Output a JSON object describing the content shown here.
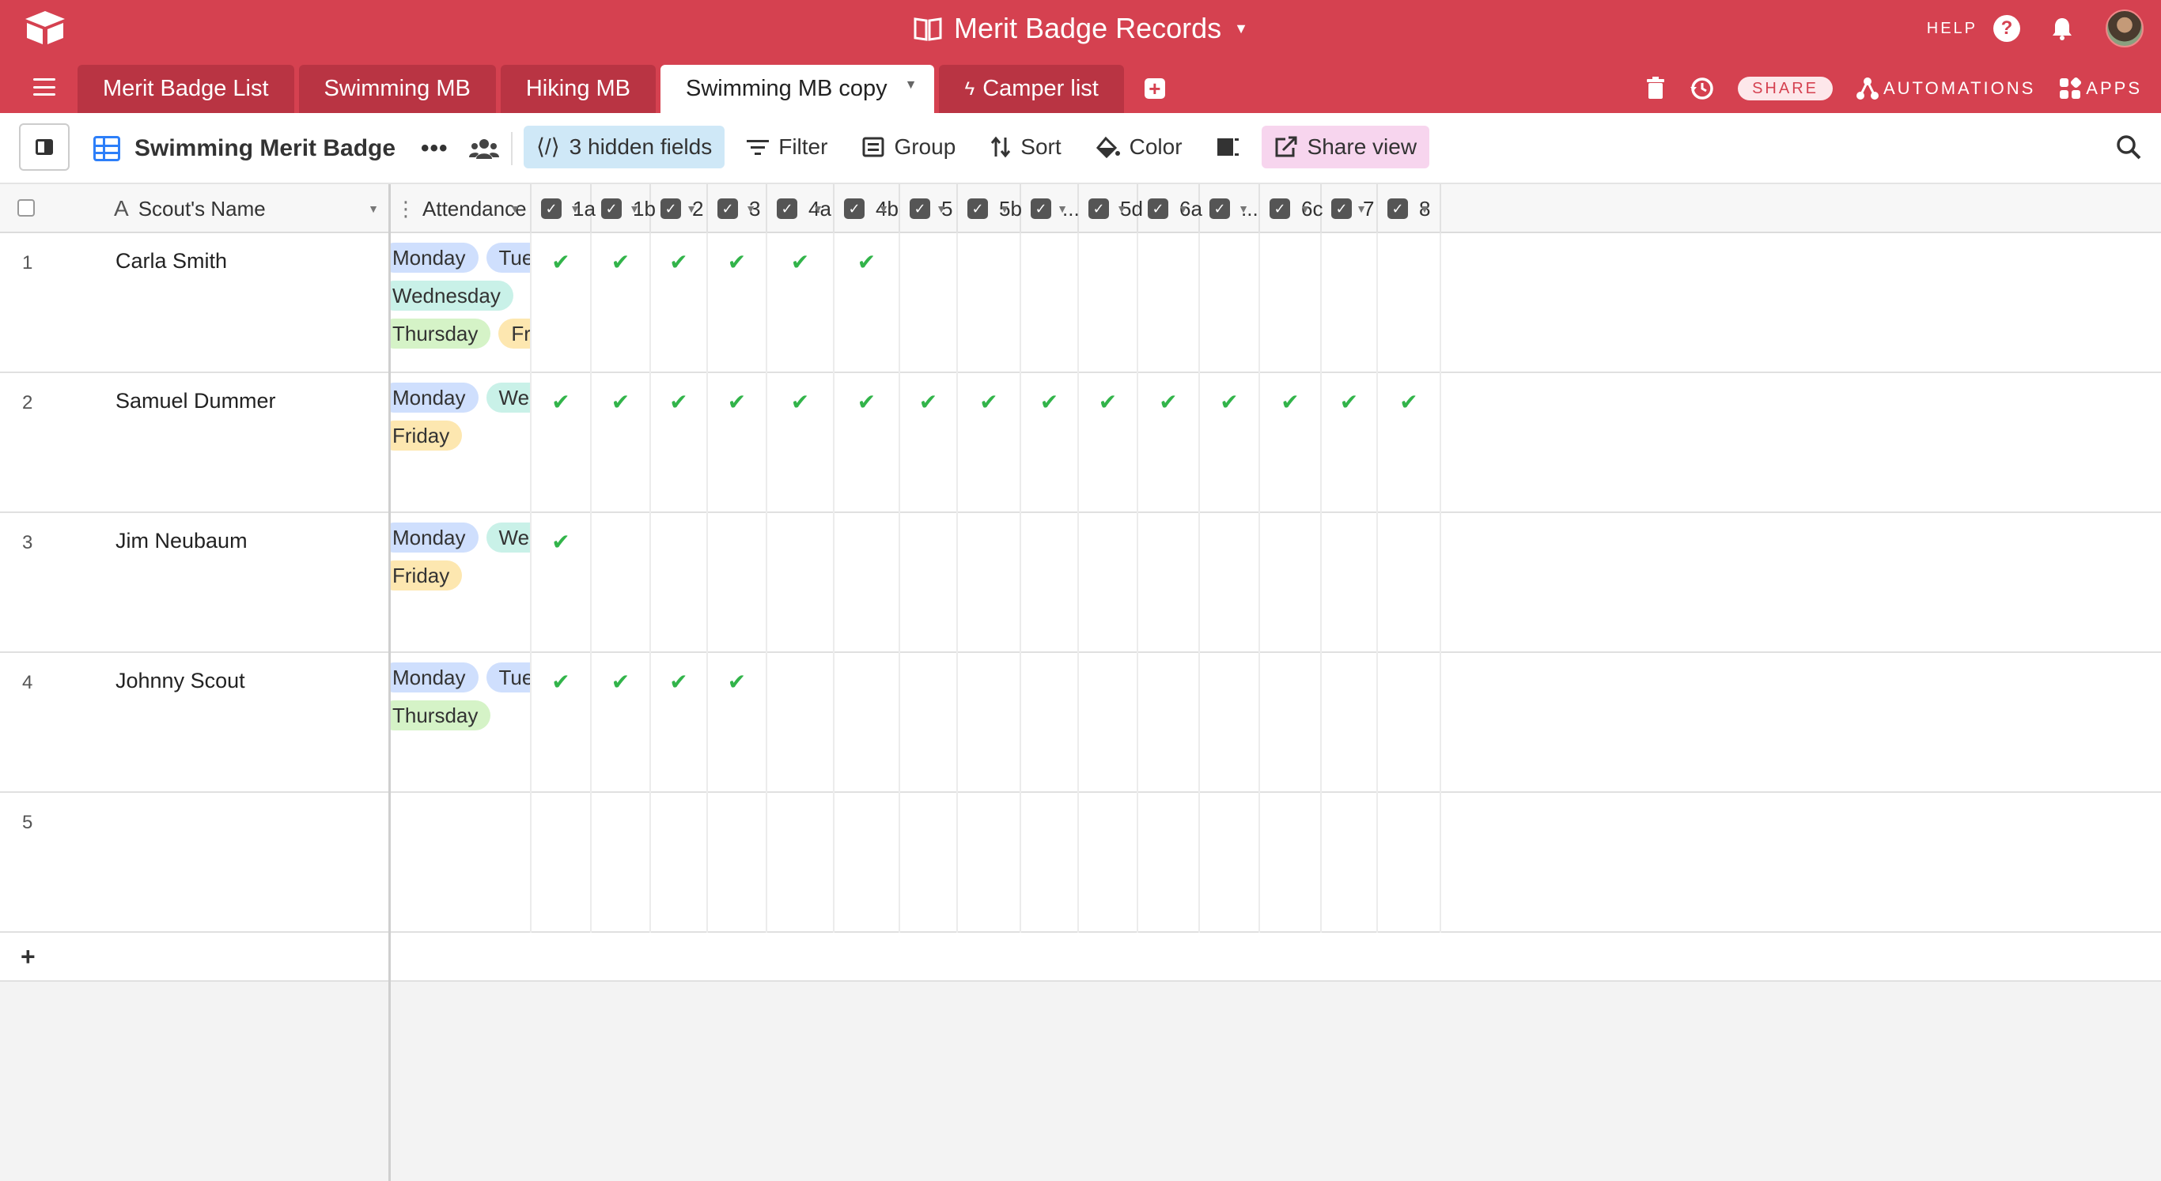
{
  "app": {
    "base_title": "Merit Badge Records",
    "help_label": "HELP",
    "share_label": "SHARE",
    "automations_label": "AUTOMATIONS",
    "apps_label": "APPS",
    "accent_color": "#d54150"
  },
  "tabs": [
    {
      "label": "Merit Badge List"
    },
    {
      "label": "Swimming MB"
    },
    {
      "label": "Hiking MB"
    },
    {
      "label": "Swimming MB copy",
      "active": true
    },
    {
      "label": "Camper list"
    }
  ],
  "view": {
    "name": "Swimming Merit Badge",
    "hidden_fields": "3 hidden fields",
    "filter": "Filter",
    "group": "Group",
    "sort": "Sort",
    "color": "Color",
    "share_view": "Share view"
  },
  "columns": {
    "primary": "Scout's Name",
    "attendance": "Attendance",
    "checks": [
      "1a",
      "1b",
      "2",
      "3",
      "4a",
      "4b",
      "5",
      "5b",
      "...",
      "5d",
      "6a",
      "...",
      "6c",
      "7",
      "8"
    ]
  },
  "rows": [
    {
      "num": "1",
      "name": "Carla Smith",
      "attendance": [
        "Monday",
        "Tuesday",
        "Wednesday",
        "Thursday",
        "Friday"
      ],
      "checked": [
        true,
        true,
        true,
        true,
        true,
        true,
        false,
        false,
        false,
        false,
        false,
        false,
        false,
        false,
        false
      ]
    },
    {
      "num": "2",
      "name": "Samuel Dummer",
      "attendance": [
        "Monday",
        "Wednesday",
        "Friday"
      ],
      "checked": [
        true,
        true,
        true,
        true,
        true,
        true,
        true,
        true,
        true,
        true,
        true,
        true,
        true,
        true,
        true
      ]
    },
    {
      "num": "3",
      "name": "Jim Neubaum",
      "attendance": [
        "Monday",
        "Wednesday",
        "Friday"
      ],
      "checked": [
        true,
        false,
        false,
        false,
        false,
        false,
        false,
        false,
        false,
        false,
        false,
        false,
        false,
        false,
        false
      ]
    },
    {
      "num": "4",
      "name": "Johnny Scout",
      "attendance": [
        "Monday",
        "Tuesday",
        "Thursday"
      ],
      "checked": [
        true,
        true,
        true,
        true,
        false,
        false,
        false,
        false,
        false,
        false,
        false,
        false,
        false,
        false,
        false
      ]
    },
    {
      "num": "5",
      "name": "",
      "attendance": [],
      "checked": [
        false,
        false,
        false,
        false,
        false,
        false,
        false,
        false,
        false,
        false,
        false,
        false,
        false,
        false,
        false
      ]
    }
  ]
}
